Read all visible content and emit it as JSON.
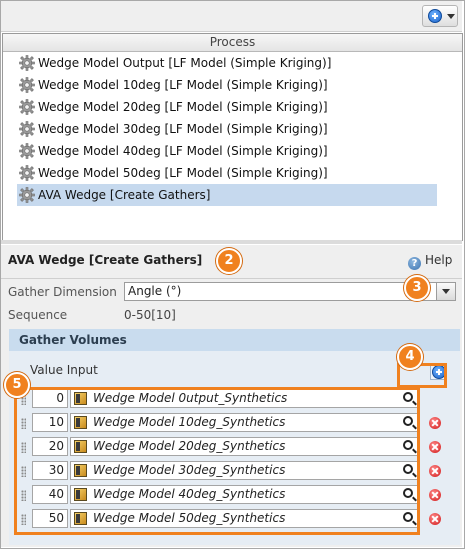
{
  "toolbar": {
    "add_menu_icon": "plus-circle-icon"
  },
  "process_list": {
    "header": "Process",
    "items": [
      {
        "label": "Wedge Model Output [LF Model (Simple Kriging)]"
      },
      {
        "label": "Wedge Model 10deg [LF Model (Simple Kriging)]"
      },
      {
        "label": "Wedge Model 20deg [LF Model (Simple Kriging)]"
      },
      {
        "label": "Wedge Model 30deg [LF Model (Simple Kriging)]"
      },
      {
        "label": "Wedge Model 40deg [LF Model (Simple Kriging)]"
      },
      {
        "label": "Wedge Model 50deg [LF Model (Simple Kriging)]"
      },
      {
        "label": "AVA Wedge [Create Gathers]",
        "selected": true
      }
    ]
  },
  "detail": {
    "title": "AVA Wedge [Create Gathers]",
    "help_label": "Help",
    "gather_dimension_label": "Gather Dimension",
    "gather_dimension_value": "Angle (°)",
    "sequence_label": "Sequence",
    "sequence_value": "0-50[10]",
    "gather_volumes": {
      "header": "Gather Volumes",
      "value_input_label": "Value Input",
      "rows": [
        {
          "value": "0",
          "volume": "Wedge Model 0utput_Synthetics",
          "deletable": false
        },
        {
          "value": "10",
          "volume": "Wedge Model 10deg_Synthetics",
          "deletable": true
        },
        {
          "value": "20",
          "volume": "Wedge Model 20deg_Synthetics",
          "deletable": true
        },
        {
          "value": "30",
          "volume": "Wedge Model 30deg_Synthetics",
          "deletable": true
        },
        {
          "value": "40",
          "volume": "Wedge Model 40deg_Synthetics",
          "deletable": true
        },
        {
          "value": "50",
          "volume": "Wedge Model 50deg_Synthetics",
          "deletable": true
        }
      ]
    }
  },
  "callouts": [
    "2",
    "3",
    "4",
    "5"
  ],
  "colors": {
    "callout": "#f0811f",
    "selection": "#c6d9ee",
    "section_header": "#c9dcee"
  }
}
